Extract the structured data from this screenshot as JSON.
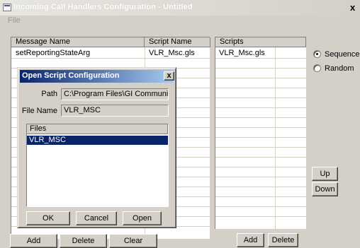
{
  "window": {
    "title": "Incoming Call Handlers Configuration - Untitled",
    "close_glyph": "x"
  },
  "menu": {
    "file": "File"
  },
  "grid": {
    "columns": [
      "Message Name",
      "Script Name"
    ],
    "rows": [
      {
        "message": "setReportingStateArg",
        "script": "VLR_Msc.gls"
      }
    ]
  },
  "scripts": {
    "header": "Scripts",
    "rows": [
      "VLR_Msc.gls"
    ]
  },
  "mode": {
    "sequence": "Sequence",
    "random": "Random",
    "selected": "Sequence"
  },
  "buttons": {
    "up": "Up",
    "down": "Down",
    "add": "Add",
    "delete": "Delete",
    "clear": "Clear",
    "scripts_add": "Add",
    "scripts_delete": "Delete"
  },
  "dialog": {
    "title": "Open Script Configuration",
    "close_glyph": "x",
    "path_label": "Path",
    "path_value": "C:\\Program Files\\GI Communicatio",
    "filename_label": "File Name",
    "filename_value": "VLR_MSC",
    "files_header": "Files",
    "files": [
      "VLR_MSC"
    ],
    "selected_file": "VLR_MSC",
    "ok": "OK",
    "cancel": "Cancel",
    "open": "Open"
  },
  "colors": {
    "face": "#d4d0c8",
    "selection": "#0a246a"
  }
}
